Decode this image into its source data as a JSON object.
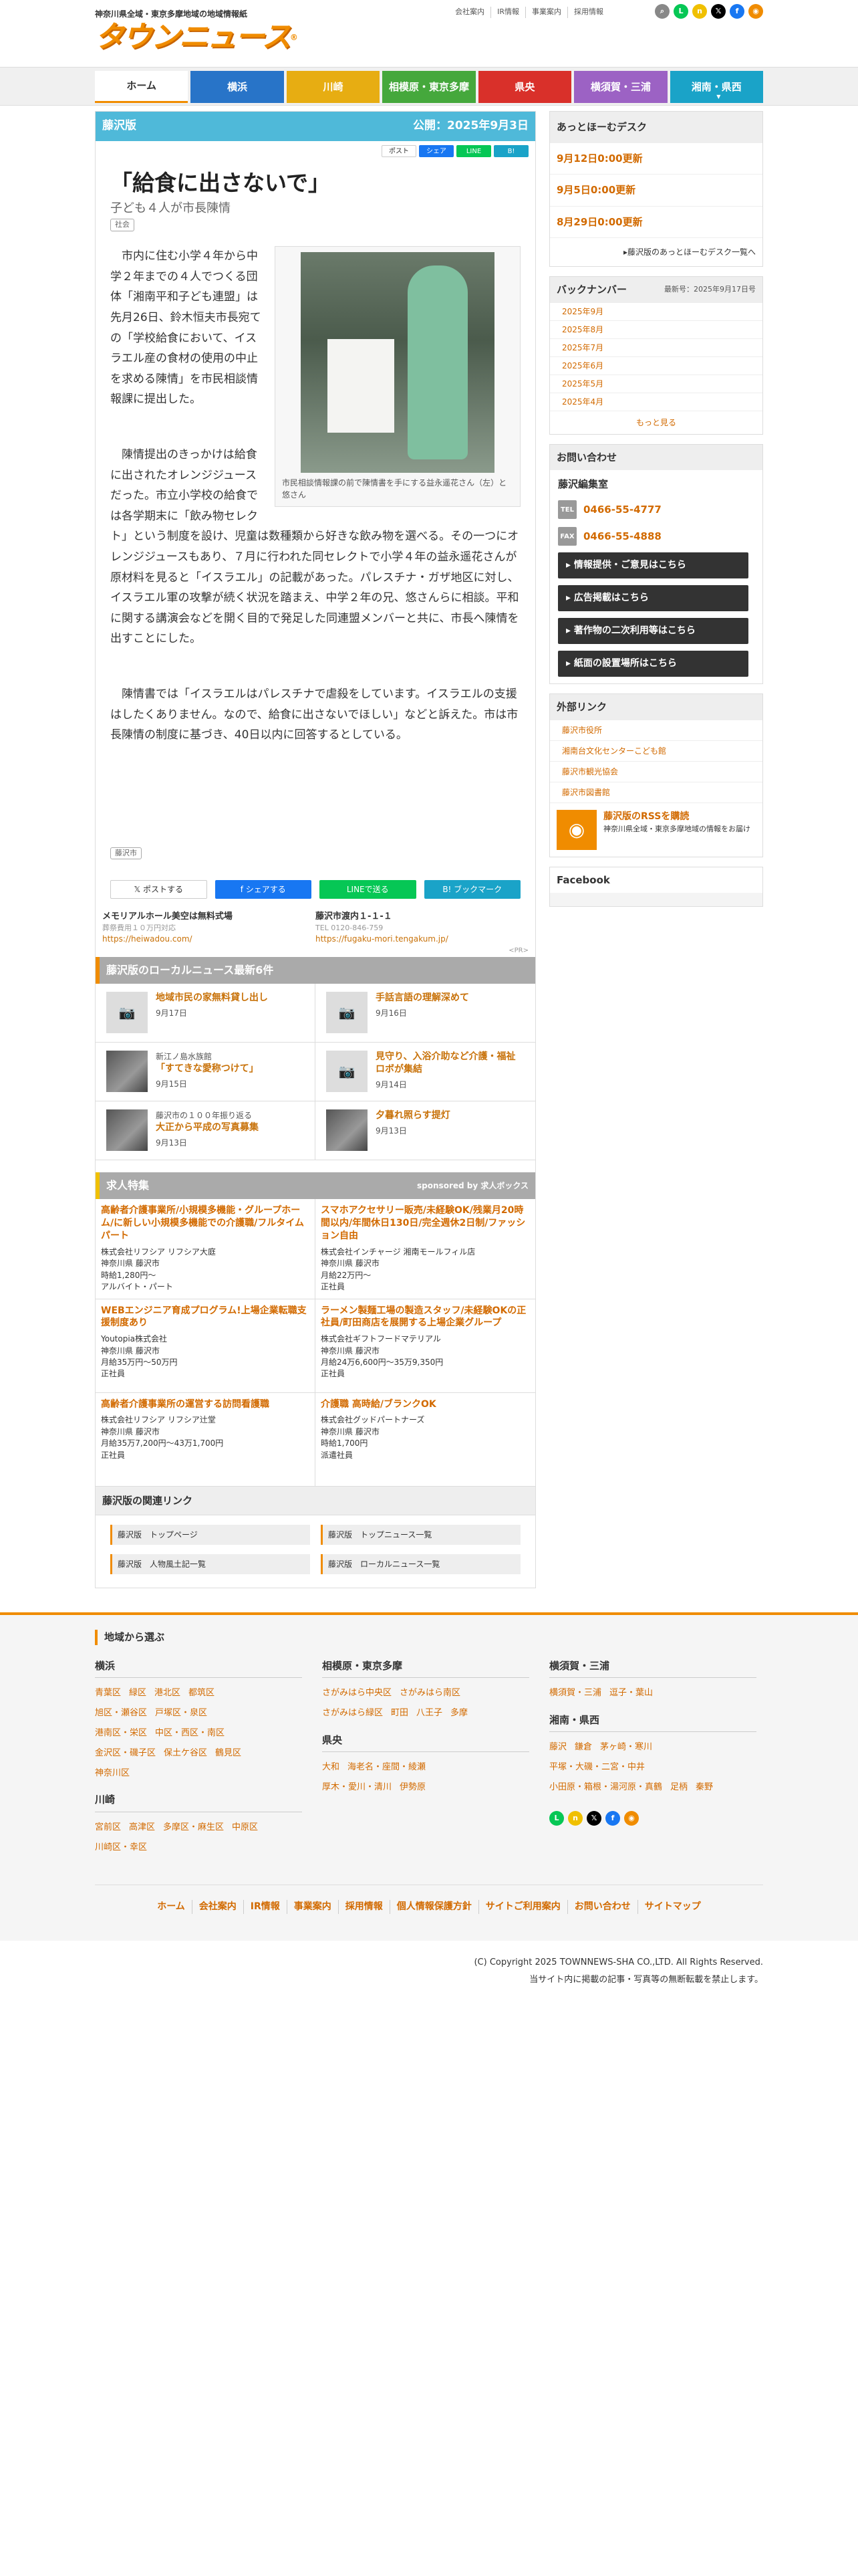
{
  "header": {
    "tagline": "神奈川県全域・東京多摩地域の地域情報紙",
    "logo": "タウンニュース",
    "logo_mark": "®",
    "toplinks": [
      "会社案内",
      "IR情報",
      "事業案内",
      "採用情報"
    ],
    "icons": [
      "search-icon",
      "line-icon",
      "note-icon",
      "x-icon",
      "facebook-icon",
      "rss-icon"
    ]
  },
  "nav": [
    {
      "label": "ホーム",
      "color": "#ffffff"
    },
    {
      "label": "横浜",
      "color": "#2874c8"
    },
    {
      "label": "川崎",
      "color": "#e7ad12"
    },
    {
      "label": "相模原・東京多摩",
      "color": "#45a83c"
    },
    {
      "label": "県央",
      "color": "#d9302a"
    },
    {
      "label": "横須賀・三浦",
      "color": "#9c62c4"
    },
    {
      "label": "湘南・県西",
      "color": "#1aa3c8"
    }
  ],
  "article": {
    "edition": "藤沢版",
    "published": "公開：2025年9月3日",
    "share_top": [
      "ポスト",
      "シェア",
      "LINE",
      "B!"
    ],
    "title": "「給食に出さないで」",
    "subtitle": "子ども４人が市長陳情",
    "tag": "社会",
    "paragraphs": [
      "市内に住む小学４年から中学２年までの４人でつくる団体「湘南平和子ども連盟」は先月26日、鈴木恒夫市長宛ての「学校給食において、イスラエル産の食材の使用の中止を求める陳情」を市民相談情報課に提出した。",
      "陳情提出のきっかけは給食に出されたオレンジジュースだった。市立小学校の給食では各学期末に「飲み物セレクト」という制度を設け、児童は数種類から好きな飲み物を選べる。その一つにオレンジジュースもあり、７月に行われた同セレクトで小学４年の益永遥花さんが原材料を見ると「イスラエル」の記載があった。パレスチナ・ガザ地区に対し、イスラエル軍の攻撃が続く状況を踏まえ、中学２年の兄、悠さんらに相談。平和に関する講演会などを開く目的で発足した同連盟メンバーと共に、市長へ陳情を出すことにした。",
      "陳情書では「イスラエルはパレスチナで虐殺をしています。イスラエルの支援はしたくありません。なので、給食に出さないでほしい」などと訴えた。市は市長陳情の制度に基づき、40日以内に回答するとしている。"
    ],
    "photo_caption": "市民相談情報課の前で陳情書を手にする益永遥花さん（左）と悠さん",
    "city_tag": "藤沢市",
    "share_bottom": [
      "ポストする",
      "シェアする",
      "LINEで送る",
      "ブックマーク"
    ],
    "ads": [
      {
        "title": "メモリアルホール美空は無料式場",
        "sub": "葬祭費用１０万円対応",
        "link": "https://heiwadou.com/"
      },
      {
        "title": "藤沢市渡内１-１-１",
        "sub": "TEL 0120-846-759",
        "link": "https://fugaku-mori.tengakum.jp/"
      }
    ],
    "pr": "<PR>"
  },
  "local_news": {
    "heading": "藤沢版のローカルニュース最新6件",
    "items": [
      {
        "sub": "",
        "title": "地域市民の家無料貸し出し",
        "date": "9月17日",
        "photo": false
      },
      {
        "sub": "",
        "title": "手話言語の理解深めて",
        "date": "9月16日",
        "photo": false
      },
      {
        "sub": "新江ノ島水族館",
        "title": "「すてきな愛称つけて」",
        "date": "9月15日",
        "photo": true
      },
      {
        "sub": "",
        "title": "見守り、入浴介助など介護・福祉ロボが集結",
        "date": "9月14日",
        "photo": false
      },
      {
        "sub": "藤沢市の１００年振り返る",
        "title": "大正から平成の写真募集",
        "date": "9月13日",
        "photo": true
      },
      {
        "sub": "",
        "title": "夕暮れ照らす提灯",
        "date": "9月13日",
        "photo": true
      }
    ]
  },
  "jobs": {
    "heading": "求人特集",
    "sponsor": "sponsored by 求人ボックス",
    "items": [
      {
        "title": "高齢者介護事業所/小規模多機能・グループホーム/に新しい小規模多機能での介護職/フルタイムパート",
        "company": "株式会社リフシア リフシア大庭",
        "place": "神奈川県 藤沢市",
        "pay": "時給1,280円～",
        "type": "アルバイト・パート"
      },
      {
        "title": "スマホアクセサリー販売/未経験OK/残業月20時間以内/年間休日130日/完全週休2日制/ファッション自由",
        "company": "株式会社インチャージ 湘南モールフィル店",
        "place": "神奈川県 藤沢市",
        "pay": "月給22万円～",
        "type": "正社員"
      },
      {
        "title": "WEBエンジニア育成プログラム!上場企業転職支援制度あり",
        "company": "Youtopia株式会社",
        "place": "神奈川県 藤沢市",
        "pay": "月給35万円～50万円",
        "type": "正社員"
      },
      {
        "title": "ラーメン製麺工場の製造スタッフ/未経験OKの正社員/町田商店を展開する上場企業グループ",
        "company": "株式会社ギフトフードマテリアル",
        "place": "神奈川県 藤沢市",
        "pay": "月給24万6,600円～35万9,350円",
        "type": "正社員"
      },
      {
        "title": "高齢者介護事業所の運営する訪問看護職",
        "company": "株式会社リフシア リフシア辻堂",
        "place": "神奈川県 藤沢市",
        "pay": "月給35万7,200円～43万1,700円",
        "type": "正社員"
      },
      {
        "title": "介護職 高時給/ブランクOK",
        "company": "株式会社グッドパートナーズ",
        "place": "神奈川県 藤沢市",
        "pay": "時給1,700円",
        "type": "派遣社員"
      }
    ]
  },
  "related": {
    "heading": "藤沢版の関連リンク",
    "links": [
      "藤沢版　トップページ",
      "藤沢版　トップニュース一覧",
      "藤沢版　人物風土記一覧",
      "藤沢版　ローカルニュース一覧"
    ]
  },
  "sidebar": {
    "desk_heading": "あっとほーむデスク",
    "desk_items": [
      "9月12日0:00更新",
      "9月5日0:00更新",
      "8月29日0:00更新"
    ],
    "desk_more": "藤沢版のあっとほーむデスク一覧へ",
    "backnumber_heading": "バックナンバー",
    "backnumber_updated": "最新号：2025年9月17日号",
    "backnumber": [
      "2025年9月",
      "2025年8月",
      "2025年7月",
      "2025年6月",
      "2025年5月",
      "2025年4月"
    ],
    "backnumber_more": "もっと見る",
    "contact_heading": "お問い合わせ",
    "contact_office": "藤沢編集室",
    "tel_label": "TEL",
    "tel": "0466-55-4777",
    "fax_label": "FAX",
    "fax": "0466-55-4888",
    "contact_buttons": [
      "情報提供・ご意見はこちら",
      "広告掲載はこちら",
      "著作物の二次利用等はこちら",
      "紙面の設置場所はこちら"
    ],
    "ext_heading": "外部リンク",
    "ext_links": [
      "藤沢市役所",
      "湘南台文化センターこども館",
      "藤沢市観光協会",
      "藤沢市図書館"
    ],
    "rss_title": "藤沢版のRSSを購読",
    "rss_desc": "神奈川県全域・東京多摩地域の情報をお届け",
    "facebook": "Facebook"
  },
  "footer": {
    "heading": "地域から選ぶ",
    "col1": [
      {
        "name": "横浜",
        "rows": [
          [
            "青葉区",
            "緑区",
            "港北区",
            "都筑区"
          ],
          [
            "旭区・瀬谷区",
            "戸塚区・泉区"
          ],
          [
            "港南区・栄区",
            "中区・西区・南区"
          ],
          [
            "金沢区・磯子区",
            "保土ケ谷区",
            "鶴見区"
          ],
          [
            "神奈川区"
          ]
        ]
      },
      {
        "name": "川崎",
        "rows": [
          [
            "宮前区",
            "高津区",
            "多摩区・麻生区",
            "中原区"
          ],
          [
            "川崎区・幸区"
          ]
        ]
      }
    ],
    "col2": [
      {
        "name": "相模原・東京多摩",
        "rows": [
          [
            "さがみはら中央区",
            "さがみはら南区"
          ],
          [
            "さがみはら緑区",
            "町田",
            "八王子",
            "多摩"
          ]
        ]
      },
      {
        "name": "県央",
        "rows": [
          [
            "大和",
            "海老名・座間・綾瀬"
          ],
          [
            "厚木・愛川・清川",
            "伊勢原"
          ]
        ]
      }
    ],
    "col3": [
      {
        "name": "横須賀・三浦",
        "rows": [
          [
            "横須賀・三浦",
            "逗子・葉山"
          ]
        ]
      },
      {
        "name": "湘南・県西",
        "rows": [
          [
            "藤沢",
            "鎌倉",
            "茅ヶ崎・寒川"
          ],
          [
            "平塚・大磯・二宮・中井"
          ],
          [
            "小田原・箱根・湯河原・真鶴",
            "足柄",
            "秦野"
          ]
        ]
      }
    ],
    "links": [
      "ホーム",
      "会社案内",
      "IR情報",
      "事業案内",
      "採用情報",
      "個人情報保護方針",
      "サイトご利用案内",
      "お問い合わせ",
      "サイトマップ"
    ],
    "copyright": "(C) Copyright 2025 TOWNNEWS-SHA CO.,LTD. All Rights Reserved.",
    "notice": "当サイト内に掲載の記事・写真等の無断転載を禁止します。"
  }
}
